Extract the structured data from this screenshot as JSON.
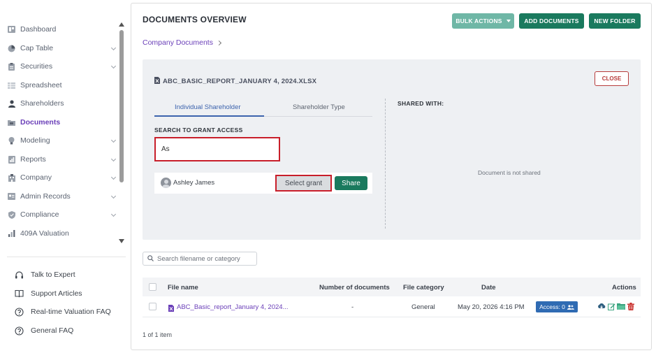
{
  "sidebar": {
    "items": [
      {
        "label": "Dashboard",
        "icon": "dashboard-icon",
        "has_children": false,
        "active": false
      },
      {
        "label": "Cap Table",
        "icon": "pie-chart-icon",
        "has_children": true,
        "active": false
      },
      {
        "label": "Securities",
        "icon": "clipboard-icon",
        "has_children": true,
        "active": false
      },
      {
        "label": "Spreadsheet",
        "icon": "table-icon",
        "has_children": false,
        "active": false
      },
      {
        "label": "Shareholders",
        "icon": "person-icon",
        "has_children": false,
        "active": false
      },
      {
        "label": "Documents",
        "icon": "folder-icon",
        "has_children": false,
        "active": true
      },
      {
        "label": "Modeling",
        "icon": "bulb-icon",
        "has_children": true,
        "active": false
      },
      {
        "label": "Reports",
        "icon": "report-icon",
        "has_children": true,
        "active": false
      },
      {
        "label": "Company",
        "icon": "building-icon",
        "has_children": true,
        "active": false
      },
      {
        "label": "Admin Records",
        "icon": "records-icon",
        "has_children": true,
        "active": false
      },
      {
        "label": "Compliance",
        "icon": "shield-icon",
        "has_children": true,
        "active": false
      },
      {
        "label": "409A Valuation",
        "icon": "bar-chart-icon",
        "has_children": false,
        "active": false
      }
    ],
    "help": [
      {
        "label": "Talk to Expert",
        "icon": "headset-icon"
      },
      {
        "label": "Support Articles",
        "icon": "book-icon"
      },
      {
        "label": "Real-time Valuation FAQ",
        "icon": "question-icon"
      },
      {
        "label": "General FAQ",
        "icon": "question-icon"
      }
    ]
  },
  "header": {
    "title": "DOCUMENTS OVERVIEW",
    "bulk_actions_label": "BULK ACTIONS",
    "add_documents_label": "ADD DOCUMENTS",
    "new_folder_label": "NEW FOLDER",
    "breadcrumb": "Company Documents"
  },
  "share_panel": {
    "file_name": "ABC_BASIC_REPORT_JANUARY 4, 2024.XLSX",
    "close_label": "CLOSE",
    "tabs": [
      {
        "label": "Individual Shareholder",
        "active": true
      },
      {
        "label": "Shareholder Type",
        "active": false
      }
    ],
    "search_label": "SEARCH TO GRANT ACCESS",
    "search_value": "As",
    "result": {
      "name": "Ashley James",
      "select_grant_label": "Select grant",
      "share_label": "Share"
    },
    "shared_with_title": "SHARED WITH:",
    "empty_message": "Document is not shared"
  },
  "documents": {
    "search_placeholder": "Search filename or category",
    "columns": [
      "File name",
      "Number of documents",
      "File category",
      "Date",
      "Actions"
    ],
    "rows": [
      {
        "file_name": "ABC_Basic_report_January 4, 2024...",
        "num_documents": "-",
        "category": "General",
        "date": "May 20, 2026 4:16 PM",
        "access_label": "Access: 0"
      }
    ],
    "pagination": "1 of 1 item"
  },
  "colors": {
    "primary_green": "#1a7a5e",
    "light_green": "#6fb7a6",
    "accent_purple": "#6a3fb8",
    "highlight_red": "#c81e2a",
    "badge_blue": "#2f6bb3"
  }
}
